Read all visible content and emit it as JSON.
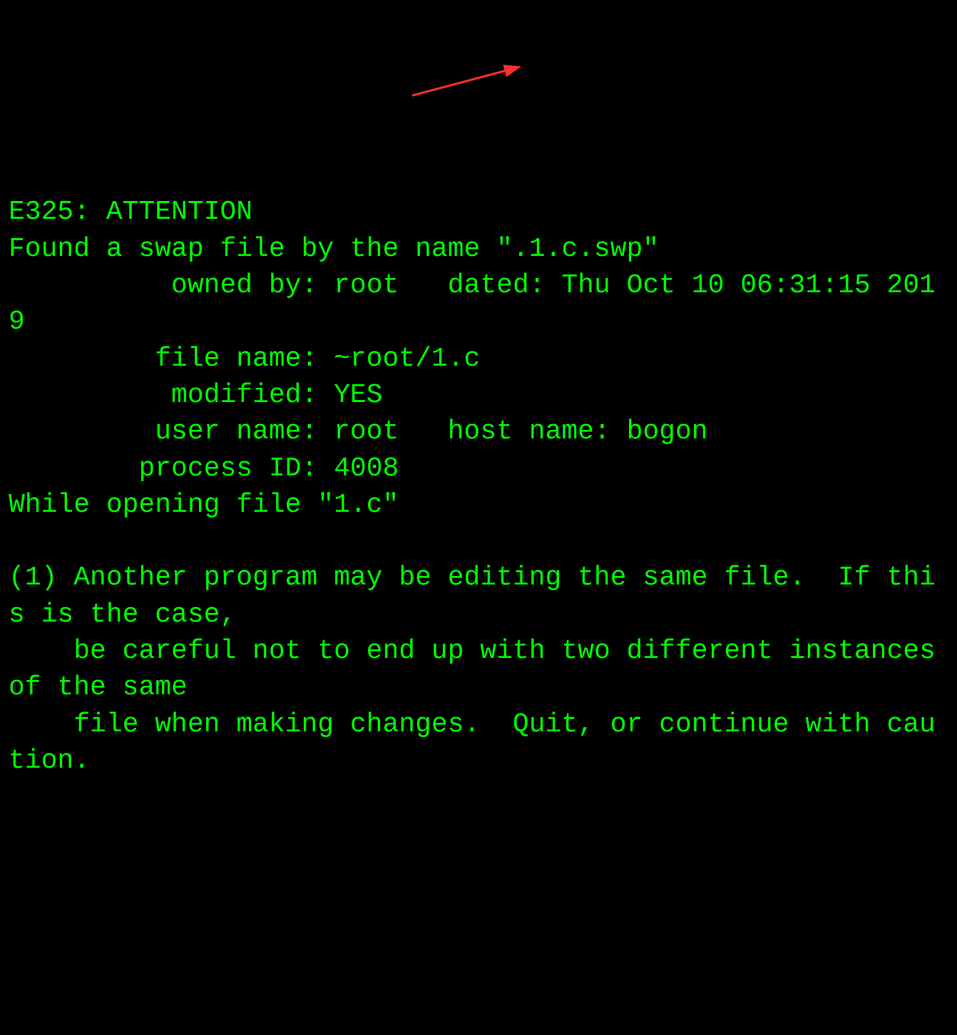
{
  "vim_swap_warning": {
    "header": "E325: ATTENTION",
    "found_line": "Found a swap file by the name \".1.c.swp\"",
    "owned_by_label": "          owned by: ",
    "owner": "root",
    "dated_label": "   dated: ",
    "dated": "Thu Oct 10 06:31:15 2019",
    "file_name_label": "         file name: ",
    "file_name": "~root/1.c",
    "modified_label": "          modified: ",
    "modified": "YES",
    "user_name_label": "         user name: ",
    "user_name": "root",
    "host_name_label": "   host name: ",
    "host_name": "bogon",
    "process_id_label": "        process ID: ",
    "process_id": "4008",
    "while_opening": "While opening file \"1.c\"",
    "blank": "",
    "reason1_line1": "(1) Another program may be editing the same file.  If this is the case,",
    "reason1_line2": "    be careful not to end up with two different instances of the same",
    "reason1_line3": "    file when making changes.  Quit, or continue with caution."
  },
  "colors": {
    "bg": "#000000",
    "fg": "#00ff00",
    "arrow": "#ff3030"
  }
}
